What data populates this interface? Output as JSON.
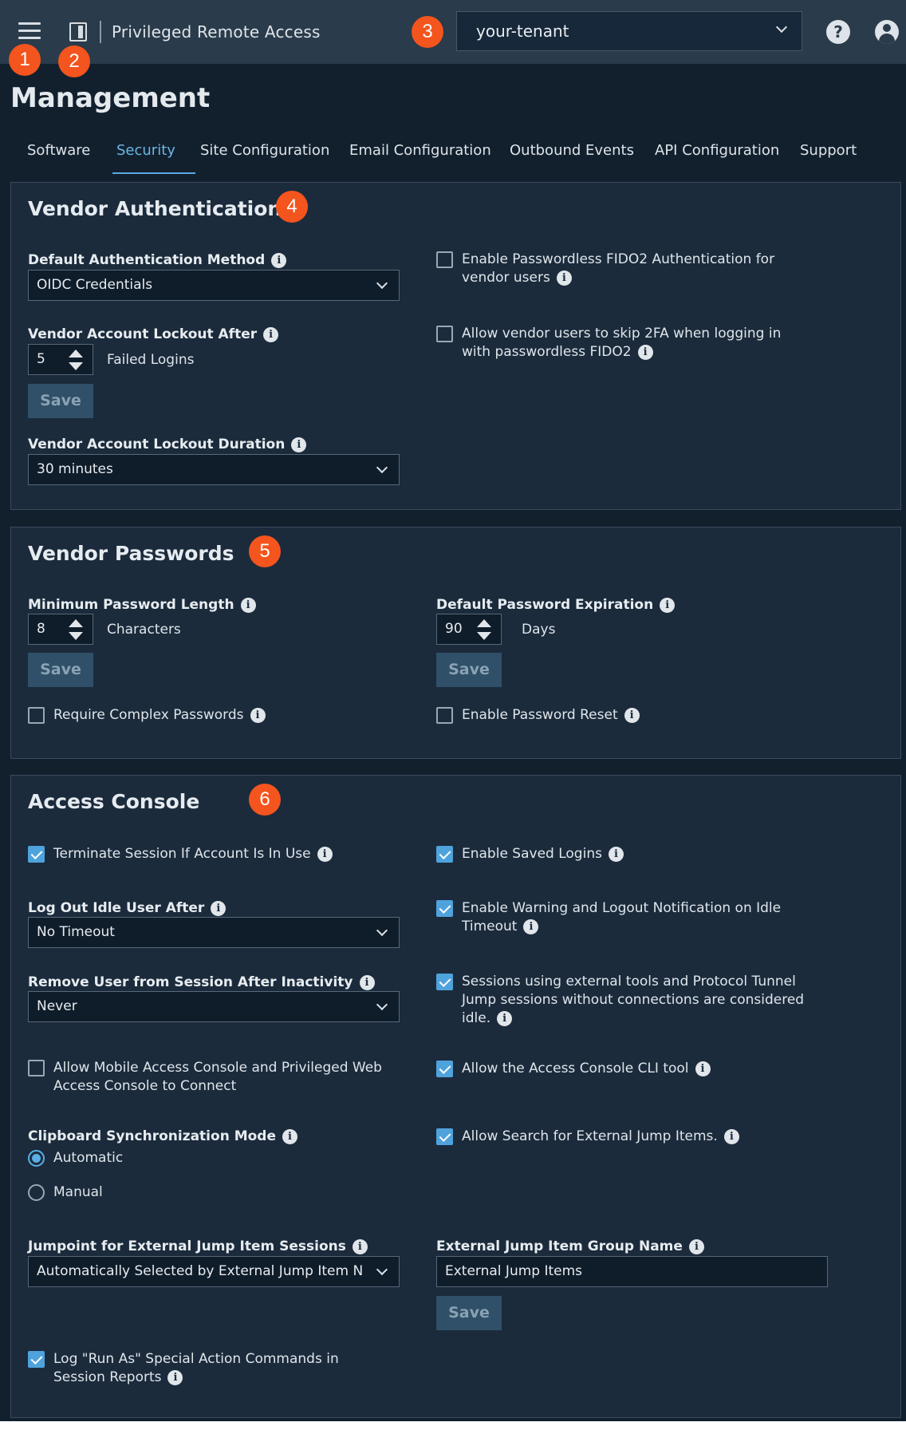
{
  "header": {
    "brand_title": "Privileged Remote Access",
    "tenant_value": "your-tenant",
    "help_glyph": "?"
  },
  "callouts": [
    "1",
    "2",
    "3",
    "4",
    "5",
    "6"
  ],
  "page": {
    "title": "Management"
  },
  "tabs": [
    "Software",
    "Security",
    "Site Configuration",
    "Email Configuration",
    "Outbound Events",
    "API Configuration",
    "Support"
  ],
  "active_tab": "Security",
  "info_glyph": "i",
  "vendor_auth": {
    "title": "Vendor Authentication",
    "default_method_label": "Default Authentication Method",
    "default_method_value": "OIDC Credentials",
    "lockout_after_label": "Vendor Account Lockout After",
    "lockout_after_value": "5",
    "lockout_after_unit": "Failed Logins",
    "save_label": "Save",
    "lockout_duration_label": "Vendor Account Lockout Duration",
    "lockout_duration_value": "30 minutes",
    "fido2_label": "Enable Passwordless FIDO2 Authentication for vendor users",
    "skip2fa_label": "Allow vendor users to skip 2FA when logging in with passwordless FIDO2"
  },
  "vendor_pw": {
    "title": "Vendor Passwords",
    "min_length_label": "Minimum Password Length",
    "min_length_value": "8",
    "min_length_unit": "Characters",
    "save_label": "Save",
    "complex_label": "Require Complex Passwords",
    "expiration_label": "Default Password Expiration",
    "expiration_value": "90",
    "expiration_unit": "Days",
    "reset_label": "Enable Password Reset"
  },
  "access_console": {
    "title": "Access Console",
    "terminate_label": "Terminate Session If Account Is In Use",
    "idle_label": "Log Out Idle User After",
    "idle_value": "No Timeout",
    "remove_label": "Remove User from Session After Inactivity",
    "remove_value": "Never",
    "mobile_label": "Allow Mobile Access Console and Privileged Web Access Console to Connect",
    "clipboard_label": "Clipboard Synchronization Mode",
    "clip_automatic": "Automatic",
    "clip_manual": "Manual",
    "jumpoint_label": "Jumpoint for External Jump Item Sessions",
    "jumpoint_value": "Automatically Selected by External Jump Item N...",
    "log_runas_label": "Log \"Run As\" Special Action Commands in Session Reports",
    "saved_logins_label": "Enable Saved Logins",
    "idle_warning_label": "Enable Warning and Logout Notification on Idle Timeout",
    "ext_tools_label": "Sessions using external tools and Protocol Tunnel Jump sessions without connections are considered idle.",
    "cli_label": "Allow the Access Console CLI tool",
    "search_ext_label": "Allow Search for External Jump Items.",
    "group_name_label": "External Jump Item Group Name",
    "group_name_value": "External Jump Items",
    "save_label": "Save"
  },
  "colors": {
    "accent": "#5aa9e0",
    "callout": "#f4541d",
    "background": "#12202e",
    "card": "#1b2b3c"
  }
}
